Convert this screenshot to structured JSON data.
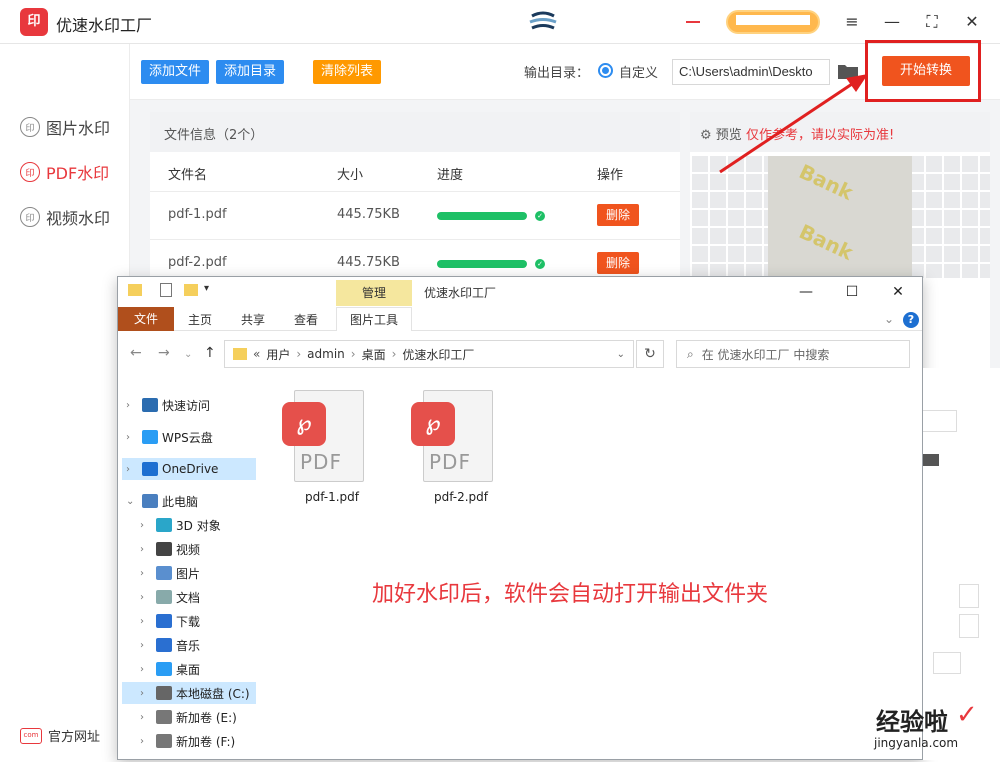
{
  "app": {
    "title": "优速水印工厂",
    "logo_text": "印",
    "window_controls": [
      "≡",
      "—",
      "⛶",
      "✕"
    ]
  },
  "sidebar": {
    "items": [
      {
        "label": "图片水印",
        "icon": "印",
        "active": false
      },
      {
        "label": "PDF水印",
        "icon": "印",
        "active": true
      },
      {
        "label": "视频水印",
        "icon": "印",
        "active": false
      }
    ],
    "footer_label": "官方网址",
    "footer_icon": "com"
  },
  "toolbar": {
    "add_file": "添加文件",
    "add_dir": "添加目录",
    "clear_list": "清除列表",
    "output_label": "输出目录：",
    "custom_label": "自定义",
    "output_path": "C:\\Users\\admin\\Deskto",
    "start_button": "开始转换"
  },
  "file_panel": {
    "header": "文件信息（2个）",
    "columns": [
      "文件名",
      "大小",
      "进度",
      "操作"
    ],
    "rows": [
      {
        "name": "pdf-1.pdf",
        "size": "445.75KB",
        "progress": 1.0,
        "action": "删除"
      },
      {
        "name": "pdf-2.pdf",
        "size": "445.75KB",
        "progress": 1.0,
        "action": "删除"
      }
    ]
  },
  "preview": {
    "label": "预览",
    "tip": "仅作参考，请以实际为准!",
    "watermark_text": "Bank"
  },
  "explorer": {
    "manage_tab": "管理",
    "title": "优速水印工厂",
    "ribbon_tabs": {
      "file": "文件",
      "home": "主页",
      "share": "共享",
      "view": "查看",
      "picture_tools": "图片工具"
    },
    "address": {
      "prefix": "«",
      "parts": [
        "用户",
        "admin",
        "桌面",
        "优速水印工厂"
      ],
      "separator": "›"
    },
    "search_placeholder": "在 优速水印工厂 中搜索",
    "nav": [
      {
        "label": "快速访问",
        "chevron": "›",
        "selected": false
      },
      {
        "label": "WPS云盘",
        "chevron": "›",
        "selected": false
      },
      {
        "label": "OneDrive",
        "chevron": "›",
        "selected": true
      },
      {
        "label": "此电脑",
        "chevron": "⌄",
        "selected": false
      },
      {
        "label": "3D 对象",
        "chevron": "›",
        "selected": false
      },
      {
        "label": "视频",
        "chevron": "›",
        "selected": false
      },
      {
        "label": "图片",
        "chevron": "›",
        "selected": false
      },
      {
        "label": "文档",
        "chevron": "›",
        "selected": false
      },
      {
        "label": "下载",
        "chevron": "›",
        "selected": false
      },
      {
        "label": "音乐",
        "chevron": "›",
        "selected": false
      },
      {
        "label": "桌面",
        "chevron": "›",
        "selected": false
      },
      {
        "label": "本地磁盘 (C:)",
        "chevron": "›",
        "selected": true
      },
      {
        "label": "新加卷 (E:)",
        "chevron": "›",
        "selected": false
      },
      {
        "label": "新加卷 (F:)",
        "chevron": "›",
        "selected": false
      }
    ],
    "files": [
      {
        "name": "pdf-1.pdf",
        "type_label": "PDF"
      },
      {
        "name": "pdf-2.pdf",
        "type_label": "PDF"
      }
    ],
    "annotation": "加好水印后，软件会自动打开输出文件夹"
  },
  "site_watermark": {
    "line1": "经验啦",
    "line2": "jingyanla.com",
    "check": "✓"
  },
  "colors": {
    "brand_red": "#e8383d",
    "start_orange": "#f0541e",
    "blue_button": "#2d8cf0",
    "orange_button": "#ff9900",
    "progress_green": "#1ec066"
  }
}
